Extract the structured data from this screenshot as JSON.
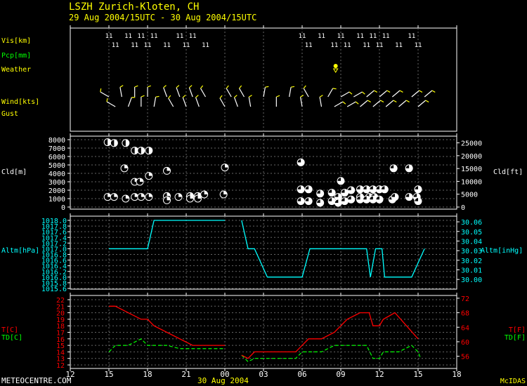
{
  "header": {
    "station": "LSZH  Zurich-Kloten,  CH",
    "period": "29 Aug 2004/15UTC - 30 Aug 2004/15UTC"
  },
  "footer": {
    "left": "METEOCENTRE.COM",
    "date": "30 Aug 2004",
    "right": "McIDAS"
  },
  "colors": {
    "white": "#ffffff",
    "yellow": "#ffff00",
    "green": "#00ff00",
    "cyan": "#00ffff",
    "red": "#ff0000",
    "grid": "#666666"
  },
  "chart_data": {
    "type": "line",
    "x_axis": {
      "unit": "UTC hour",
      "range": [
        12,
        42
      ],
      "tick_values": [
        12,
        15,
        18,
        21,
        24,
        27,
        30,
        33,
        36,
        39,
        42
      ],
      "tick_labels": [
        "12",
        "15",
        "18",
        "21",
        "00",
        "03",
        "06",
        "09",
        "12",
        "15",
        "18"
      ]
    },
    "obs_panel": {
      "row_labels": {
        "vis": "Vis[km]",
        "pcp": "Pcp[mm]",
        "weather": "Weather",
        "wind": "Wind[kts]",
        "gust": "Gust"
      },
      "vis": [
        {
          "t": 15.0,
          "v": "11"
        },
        {
          "t": 15.5,
          "v": "11"
        },
        {
          "t": 16.5,
          "v": "11"
        },
        {
          "t": 17.0,
          "v": "11"
        },
        {
          "t": 17.5,
          "v": "11"
        },
        {
          "t": 18.0,
          "v": "11"
        },
        {
          "t": 18.5,
          "v": "11"
        },
        {
          "t": 19.5,
          "v": "11"
        },
        {
          "t": 20.5,
          "v": "11"
        },
        {
          "t": 21.0,
          "v": "11"
        },
        {
          "t": 21.5,
          "v": "11"
        },
        {
          "t": 22.5,
          "v": "11"
        },
        {
          "t": 30.0,
          "v": "11"
        },
        {
          "t": 30.5,
          "v": "11"
        },
        {
          "t": 31.5,
          "v": "11"
        },
        {
          "t": 32.5,
          "v": "11"
        },
        {
          "t": 33.0,
          "v": "11"
        },
        {
          "t": 33.5,
          "v": "11"
        },
        {
          "t": 34.5,
          "v": "11"
        },
        {
          "t": 35.0,
          "v": "11"
        },
        {
          "t": 35.5,
          "v": "11"
        },
        {
          "t": 36.0,
          "v": "11"
        },
        {
          "t": 36.5,
          "v": "11"
        },
        {
          "t": 37.5,
          "v": "11"
        },
        {
          "t": 38.5,
          "v": "11"
        },
        {
          "t": 39.0,
          "v": "11"
        }
      ],
      "weather": [
        {
          "t": 32.6,
          "symbol": "rain-shower"
        }
      ],
      "wind": [
        {
          "t": 15.0,
          "dir": 300
        },
        {
          "t": 15.5,
          "dir": 300
        },
        {
          "t": 16.0,
          "dir": 350
        },
        {
          "t": 16.5,
          "dir": 20
        },
        {
          "t": 17.0,
          "dir": 360
        },
        {
          "t": 17.5,
          "dir": 360
        },
        {
          "t": 18.0,
          "dir": 360
        },
        {
          "t": 18.5,
          "dir": 10
        },
        {
          "t": 19.5,
          "dir": 340
        },
        {
          "t": 20.0,
          "dir": 330
        },
        {
          "t": 20.5,
          "dir": 340
        },
        {
          "t": 21.0,
          "dir": 340
        },
        {
          "t": 21.5,
          "dir": 340
        },
        {
          "t": 22.0,
          "dir": 340
        },
        {
          "t": 22.5,
          "dir": 330
        },
        {
          "t": 24.0,
          "dir": 330
        },
        {
          "t": 24.5,
          "dir": 330
        },
        {
          "t": 25.0,
          "dir": 340
        },
        {
          "t": 25.5,
          "dir": 330
        },
        {
          "t": 26.0,
          "dir": 350
        },
        {
          "t": 27.0,
          "dir": 10
        },
        {
          "t": 28.0,
          "dir": 360
        },
        {
          "t": 29.0,
          "dir": 10
        },
        {
          "t": 30.0,
          "dir": 350
        },
        {
          "t": 30.5,
          "dir": 330
        },
        {
          "t": 31.5,
          "dir": 350
        },
        {
          "t": 32.0,
          "dir": 30
        },
        {
          "t": 32.5,
          "dir": 60
        },
        {
          "t": 33.0,
          "dir": 60
        },
        {
          "t": 33.5,
          "dir": 60
        },
        {
          "t": 34.0,
          "dir": 60
        },
        {
          "t": 34.5,
          "dir": 50
        },
        {
          "t": 35.0,
          "dir": 50
        },
        {
          "t": 35.5,
          "dir": 50
        },
        {
          "t": 36.0,
          "dir": 50
        },
        {
          "t": 36.5,
          "dir": 50
        },
        {
          "t": 37.0,
          "dir": 50
        },
        {
          "t": 37.5,
          "dir": 50
        },
        {
          "t": 38.5,
          "dir": 50
        },
        {
          "t": 39.0,
          "dir": 50
        },
        {
          "t": 39.5,
          "dir": 50
        }
      ]
    },
    "cloud_panel": {
      "ylabel_left": "Cld[m]",
      "ylabel_right": "Cld[ft]",
      "ylim_m": [
        0,
        8000
      ],
      "yticks_m": [
        "0",
        "1000",
        "2000",
        "3000",
        "4000",
        "5000",
        "6000",
        "7000",
        "8000"
      ],
      "yticks_ft": [
        "0",
        "5000",
        "10000",
        "15000",
        "20000",
        "25000"
      ],
      "clouds": [
        {
          "t": 14.9,
          "h": 7700,
          "c": 0.5
        },
        {
          "t": 15.4,
          "h": 7600,
          "c": 0.5
        },
        {
          "t": 16.3,
          "h": 7600,
          "c": 0.5
        },
        {
          "t": 17.0,
          "h": 6700,
          "c": 0.5
        },
        {
          "t": 17.5,
          "h": 6700,
          "c": 0.5
        },
        {
          "t": 18.1,
          "h": 6700,
          "c": 0.5
        },
        {
          "t": 16.2,
          "h": 4600,
          "c": 0.25
        },
        {
          "t": 18.1,
          "h": 3700,
          "c": 0.25
        },
        {
          "t": 17.0,
          "h": 3000,
          "c": 0.25
        },
        {
          "t": 17.4,
          "h": 3000,
          "c": 0.25
        },
        {
          "t": 19.5,
          "h": 4300,
          "c": 0.25
        },
        {
          "t": 24.0,
          "h": 4700,
          "c": 0.25
        },
        {
          "t": 14.9,
          "h": 1200,
          "c": 0.25
        },
        {
          "t": 15.4,
          "h": 1200,
          "c": 0.25
        },
        {
          "t": 16.3,
          "h": 1000,
          "c": 0.25
        },
        {
          "t": 17.0,
          "h": 1200,
          "c": 0.25
        },
        {
          "t": 17.5,
          "h": 1200,
          "c": 0.25
        },
        {
          "t": 18.1,
          "h": 1200,
          "c": 0.25
        },
        {
          "t": 19.5,
          "h": 1300,
          "c": 0.25
        },
        {
          "t": 19.5,
          "h": 800,
          "c": 0.25
        },
        {
          "t": 20.4,
          "h": 1200,
          "c": 0.25
        },
        {
          "t": 21.3,
          "h": 1300,
          "c": 0.25
        },
        {
          "t": 21.9,
          "h": 1300,
          "c": 0.25
        },
        {
          "t": 22.4,
          "h": 1500,
          "c": 0.25
        },
        {
          "t": 23.9,
          "h": 1500,
          "c": 0.25
        },
        {
          "t": 21.3,
          "h": 1000,
          "c": 0.25
        },
        {
          "t": 21.9,
          "h": 1000,
          "c": 0.25
        },
        {
          "t": 29.9,
          "h": 5300,
          "c": 0.75
        },
        {
          "t": 29.9,
          "h": 2100,
          "c": 0.75
        },
        {
          "t": 30.5,
          "h": 2100,
          "c": 0.75
        },
        {
          "t": 29.9,
          "h": 700,
          "c": 0.75
        },
        {
          "t": 30.5,
          "h": 700,
          "c": 0.75
        },
        {
          "t": 31.4,
          "h": 1600,
          "c": 0.75
        },
        {
          "t": 31.4,
          "h": 500,
          "c": 0.75
        },
        {
          "t": 32.3,
          "h": 1700,
          "c": 0.75
        },
        {
          "t": 32.3,
          "h": 700,
          "c": 0.75
        },
        {
          "t": 32.8,
          "h": 1200,
          "c": 0.75
        },
        {
          "t": 32.8,
          "h": 500,
          "c": 0.75
        },
        {
          "t": 33.3,
          "h": 1700,
          "c": 0.75
        },
        {
          "t": 33.3,
          "h": 700,
          "c": 0.75
        },
        {
          "t": 33.0,
          "h": 3100,
          "c": 0.75
        },
        {
          "t": 33.8,
          "h": 2000,
          "c": 0.75
        },
        {
          "t": 33.8,
          "h": 900,
          "c": 0.75
        },
        {
          "t": 34.5,
          "h": 1200,
          "c": 0.75
        },
        {
          "t": 35.2,
          "h": 1200,
          "c": 0.75
        },
        {
          "t": 35.6,
          "h": 1200,
          "c": 0.75
        },
        {
          "t": 34.5,
          "h": 2100,
          "c": 0.75
        },
        {
          "t": 35.0,
          "h": 2100,
          "c": 0.75
        },
        {
          "t": 35.5,
          "h": 2100,
          "c": 0.75
        },
        {
          "t": 36.0,
          "h": 2100,
          "c": 0.75
        },
        {
          "t": 36.4,
          "h": 2100,
          "c": 0.75
        },
        {
          "t": 34.5,
          "h": 900,
          "c": 0.75
        },
        {
          "t": 35.0,
          "h": 900,
          "c": 0.75
        },
        {
          "t": 35.5,
          "h": 900,
          "c": 0.75
        },
        {
          "t": 36.0,
          "h": 900,
          "c": 0.75
        },
        {
          "t": 37.0,
          "h": 900,
          "c": 0.75
        },
        {
          "t": 37.1,
          "h": 4600,
          "c": 0.75
        },
        {
          "t": 37.2,
          "h": 1200,
          "c": 0.75
        },
        {
          "t": 38.3,
          "h": 4600,
          "c": 0.75
        },
        {
          "t": 38.3,
          "h": 1200,
          "c": 0.75
        },
        {
          "t": 39.0,
          "h": 2100,
          "c": 0.75
        },
        {
          "t": 38.9,
          "h": 1200,
          "c": 0.75
        },
        {
          "t": 39.0,
          "h": 700,
          "c": 0.75
        }
      ]
    },
    "altimeter_panel": {
      "ylabel_left": "Altm[hPa]",
      "ylabel_right": "Altm[inHg]",
      "ylim_hpa": [
        1015.6,
        1018.0
      ],
      "yticks_hpa": [
        "1015.6",
        "1015.8",
        "1016.0",
        "1016.2",
        "1016.4",
        "1016.6",
        "1016.8",
        "1017.0",
        "1017.2",
        "1017.4",
        "1017.6",
        "1017.8",
        "1018.0"
      ],
      "yticks_inhg": [
        "30.00",
        "30.01",
        "30.02",
        "30.03",
        "30.04",
        "30.05",
        "30.06"
      ],
      "segments": [
        [
          [
            15.0,
            1017.0
          ],
          [
            18.0,
            1017.0
          ],
          [
            18.5,
            1018.0
          ],
          [
            24.0,
            1018.0
          ]
        ],
        [
          [
            25.3,
            1018.0
          ],
          [
            25.8,
            1017.0
          ],
          [
            26.3,
            1017.0
          ],
          [
            27.3,
            1016.0
          ],
          [
            30.0,
            1016.0
          ],
          [
            30.6,
            1017.0
          ],
          [
            35.0,
            1017.0
          ],
          [
            35.3,
            1016.0
          ],
          [
            35.7,
            1017.0
          ],
          [
            36.2,
            1017.0
          ],
          [
            36.4,
            1016.0
          ],
          [
            38.5,
            1016.0
          ],
          [
            39.0,
            1016.5
          ],
          [
            39.5,
            1017.0
          ]
        ]
      ]
    },
    "temp_panel": {
      "ylabel_left_t": "T[C]",
      "ylabel_left_td": "TD[C]",
      "ylabel_right_t": "T[F]",
      "ylabel_right_td": "TD[F]",
      "ylim_c": [
        12,
        22
      ],
      "yticks_c": [
        "12",
        "13",
        "14",
        "15",
        "16",
        "17",
        "18",
        "19",
        "20",
        "21",
        "22"
      ],
      "yticks_f": [
        "56",
        "60",
        "64",
        "68",
        "72"
      ],
      "t_segments": [
        [
          [
            15.0,
            21.0
          ],
          [
            15.5,
            21.0
          ],
          [
            17.5,
            19.0
          ],
          [
            18.0,
            19.0
          ],
          [
            18.5,
            18.0
          ],
          [
            21.5,
            15.0
          ],
          [
            24.0,
            15.0
          ]
        ],
        [
          [
            25.3,
            13.5
          ],
          [
            25.8,
            13.0
          ],
          [
            26.3,
            14.0
          ],
          [
            29.5,
            14.0
          ],
          [
            30.0,
            15.0
          ],
          [
            30.5,
            16.0
          ],
          [
            31.5,
            16.0
          ],
          [
            32.5,
            17.0
          ],
          [
            33.5,
            19.0
          ],
          [
            34.5,
            20.0
          ],
          [
            35.2,
            20.0
          ],
          [
            35.5,
            18.0
          ],
          [
            36.0,
            18.0
          ],
          [
            36.3,
            19.0
          ],
          [
            37.2,
            20.0
          ],
          [
            39.0,
            16.0
          ]
        ]
      ],
      "td_segments": [
        [
          [
            15.0,
            14.0
          ],
          [
            15.5,
            15.0
          ],
          [
            16.5,
            15.0
          ],
          [
            17.5,
            16.0
          ],
          [
            18.0,
            15.0
          ],
          [
            19.5,
            15.0
          ],
          [
            20.5,
            14.5
          ],
          [
            24.0,
            14.5
          ]
        ],
        [
          [
            25.3,
            13.5
          ],
          [
            25.8,
            12.5
          ],
          [
            26.3,
            13.0
          ],
          [
            29.5,
            13.0
          ],
          [
            30.0,
            14.0
          ],
          [
            31.5,
            14.0
          ],
          [
            32.5,
            15.0
          ],
          [
            35.0,
            15.0
          ],
          [
            35.5,
            13.0
          ],
          [
            36.0,
            13.0
          ],
          [
            36.3,
            14.0
          ],
          [
            37.5,
            14.0
          ],
          [
            38.5,
            15.0
          ],
          [
            39.0,
            14.0
          ],
          [
            39.2,
            13.0
          ]
        ]
      ]
    }
  }
}
